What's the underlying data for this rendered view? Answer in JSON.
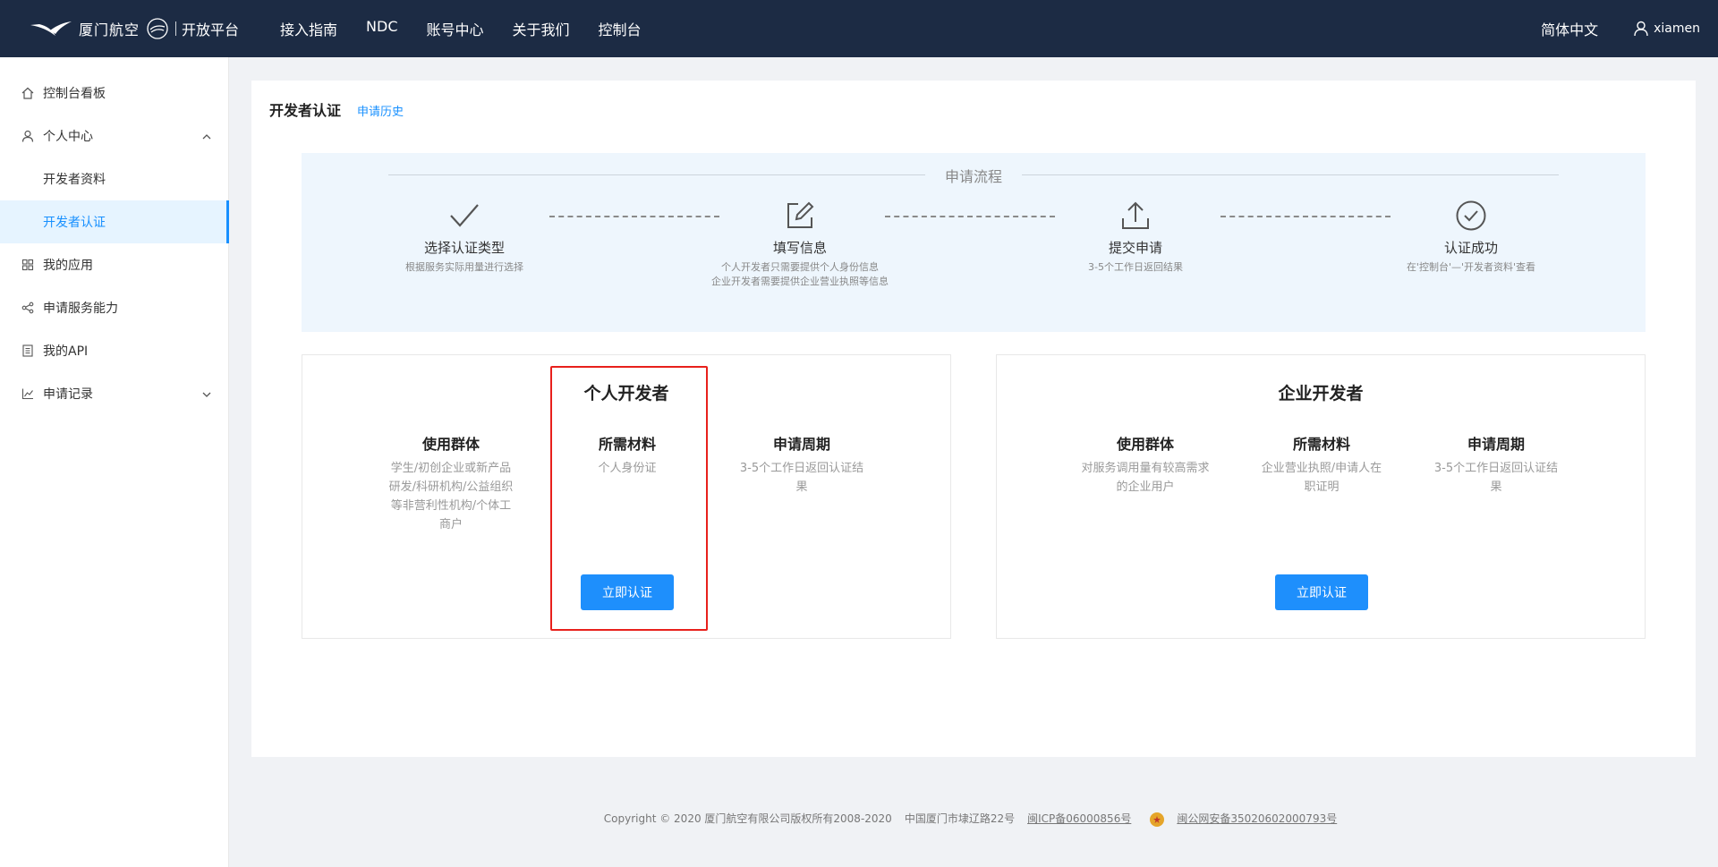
{
  "header": {
    "logo_text": "厦门航空",
    "platform": "开放平台",
    "nav": [
      "接入指南",
      "NDC",
      "账号中心",
      "关于我们",
      "控制台"
    ],
    "language": "简体中文",
    "username": "xiamen"
  },
  "sidebar": {
    "items": [
      {
        "label": "控制台看板",
        "icon": "home-icon"
      },
      {
        "label": "个人中心",
        "icon": "user-icon",
        "expanded": true
      },
      {
        "label": "开发者资料"
      },
      {
        "label": "开发者认证",
        "active": true
      },
      {
        "label": "我的应用",
        "icon": "apps-icon"
      },
      {
        "label": "申请服务能力",
        "icon": "share-icon"
      },
      {
        "label": "我的API",
        "icon": "document-icon"
      },
      {
        "label": "申请记录",
        "icon": "chart-icon",
        "expanded": false
      }
    ]
  },
  "main": {
    "title": "开发者认证",
    "history_link": "申请历史",
    "process": {
      "title": "申请流程",
      "steps": [
        {
          "name": "选择认证类型",
          "desc": [
            "根据服务实际用量进行选择"
          ],
          "icon": "check-icon"
        },
        {
          "name": "填写信息",
          "desc": [
            "个人开发者只需要提供个人身份信息",
            "企业开发者需要提供企业营业执照等信息"
          ],
          "icon": "edit-icon"
        },
        {
          "name": "提交申请",
          "desc": [
            "3-5个工作日返回结果"
          ],
          "icon": "upload-icon"
        },
        {
          "name": "认证成功",
          "desc": [
            "在'控制台'—'开发者资料'查看"
          ],
          "icon": "check-circle-icon"
        }
      ]
    },
    "cards": [
      {
        "title": "个人开发者",
        "columns": [
          {
            "header": "使用群体",
            "lines": [
              "学生/初创企业或新产品",
              "研发/科研机构/公益组织",
              "等非营利性机构/个体工",
              "商户"
            ]
          },
          {
            "header": "所需材料",
            "lines": [
              "个人身份证"
            ]
          },
          {
            "header": "申请周期",
            "lines": [
              "3-5个工作日返回认证结",
              "果"
            ]
          }
        ],
        "button": "立即认证"
      },
      {
        "title": "企业开发者",
        "columns": [
          {
            "header": "使用群体",
            "lines": [
              "对服务调用量有较高需求",
              "的企业用户"
            ]
          },
          {
            "header": "所需材料",
            "lines": [
              "企业营业执照/申请人在",
              "职证明"
            ]
          },
          {
            "header": "申请周期",
            "lines": [
              "3-5个工作日返回认证结",
              "果"
            ]
          }
        ],
        "button": "立即认证"
      }
    ]
  },
  "footer": {
    "copyright": "Copyright © 2020 厦门航空有限公司版权所有2008-2020",
    "address": "中国厦门市埭辽路22号",
    "icp": "闽ICP备06000856号",
    "police": "闽公网安备35020602000793号"
  },
  "colors": {
    "header": "#1c2b44",
    "accent": "#1890ff",
    "button": "#1e8ffc",
    "highlight": "#e8201c",
    "process_bg": "#eef6fd"
  }
}
